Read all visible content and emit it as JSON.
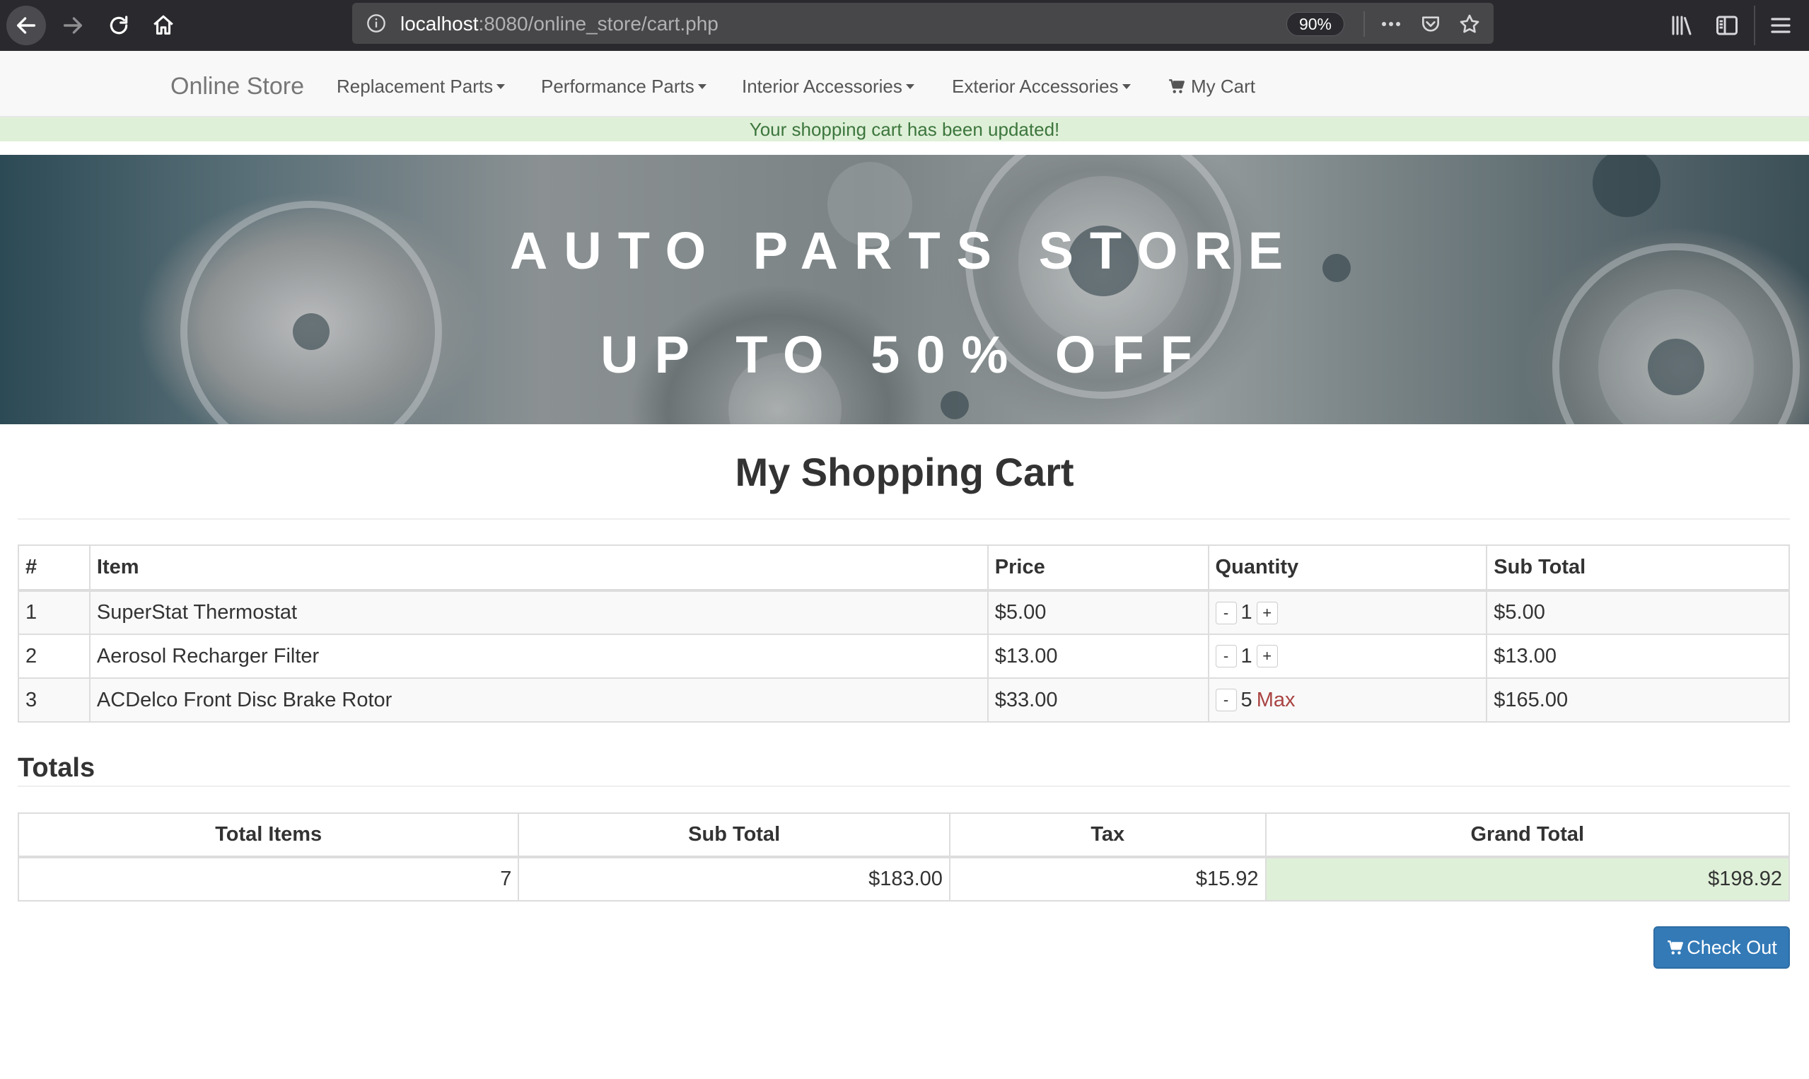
{
  "browser": {
    "url_host": "localhost",
    "url_path": ":8080/online_store/cart.php",
    "zoom": "90%"
  },
  "navbar": {
    "brand": "Online Store",
    "items": [
      {
        "label": "Replacement Parts"
      },
      {
        "label": "Performance Parts"
      },
      {
        "label": "Interior Accessories"
      },
      {
        "label": "Exterior Accessories"
      }
    ],
    "cart_label": "My Cart"
  },
  "alert": {
    "message": "Your shopping cart has been updated!",
    "color": "#dff0d8"
  },
  "banner": {
    "title": "AUTO PARTS STORE",
    "subtitle": "UP TO 50% OFF"
  },
  "cart": {
    "title": "My Shopping Cart",
    "columns": [
      "#",
      "Item",
      "Price",
      "Quantity",
      "Sub Total"
    ],
    "rows": [
      {
        "num": "1",
        "item": "SuperStat Thermostat",
        "price": "$5.00",
        "qty": "1",
        "qty_max": "",
        "subtotal": "$5.00"
      },
      {
        "num": "2",
        "item": "Aerosol Recharger Filter",
        "price": "$13.00",
        "qty": "1",
        "qty_max": "",
        "subtotal": "$13.00"
      },
      {
        "num": "3",
        "item": "ACDelco Front Disc Brake Rotor",
        "price": "$33.00",
        "qty": "5",
        "qty_max": "Max",
        "subtotal": "$165.00"
      }
    ],
    "decrement_label": "-",
    "increment_label": "+"
  },
  "totals": {
    "heading": "Totals",
    "columns": [
      "Total Items",
      "Sub Total",
      "Tax",
      "Grand Total"
    ],
    "total_items": "7",
    "sub_total": "$183.00",
    "tax": "$15.92",
    "grand_total": "$198.92"
  },
  "checkout": {
    "label": "Check Out",
    "color": "#337ab7"
  }
}
